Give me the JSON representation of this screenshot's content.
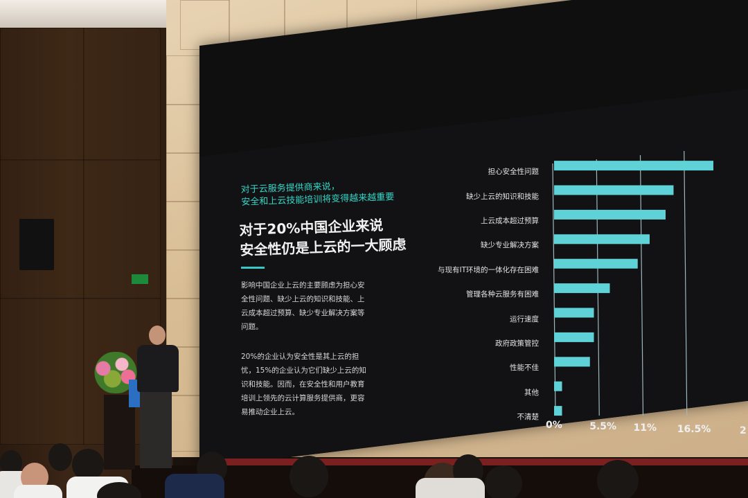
{
  "slide": {
    "subtitle_lines": [
      "对于云服务提供商来说，",
      "安全和上云技能培训将变得越来越重要"
    ],
    "headline_lines": [
      "对于20%中国企业来说",
      "安全性仍是上云的一大顾虑"
    ],
    "paragraph1_lines": [
      "影响中国企业上云的主要顾虑为担心安",
      "全性问题、缺少上云的知识和技能、上",
      "云成本超过预算、缺少专业解决方案等",
      "问题。"
    ],
    "paragraph2_lines": [
      "20%的企业认为安全性是其上云的担",
      "忧，15%的企业认为它们缺少上云的知",
      "识和技能。因而，在安全性和用户教育",
      "培训上领先的云计算服务提供商，更容",
      "易推动企业上云。"
    ]
  },
  "chart_data": {
    "type": "bar",
    "orientation": "horizontal",
    "categories": [
      "担心安全性问题",
      "缺少上云的知识和技能",
      "上云成本超过预算",
      "缺少专业解决方案",
      "与现有IT环境的一体化存在困难",
      "管理各种云服务有困难",
      "运行速度",
      "政府政策管控",
      "性能不佳",
      "其他",
      "不清楚"
    ],
    "values": [
      20.0,
      15.0,
      14.0,
      12.0,
      10.5,
      7.0,
      5.0,
      5.0,
      4.5,
      1.0,
      1.0
    ],
    "x_ticks": [
      "0%",
      "5.5%",
      "11%",
      "16.5%",
      "2"
    ],
    "xlim": [
      0,
      22
    ],
    "grid": true,
    "bar_color": "#5fd2d8"
  },
  "colors": {
    "accent_teal": "#34d6c7",
    "bar": "#5fd2d8",
    "slide_bg": "#121214"
  }
}
